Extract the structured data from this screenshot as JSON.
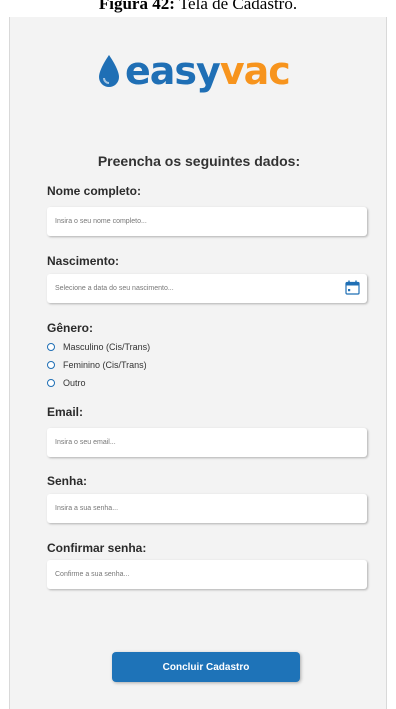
{
  "caption": {
    "figure": "Figura 42:",
    "title": "Tela de Cadastro."
  },
  "brand": {
    "part1": "easy",
    "part2": "vac",
    "primary_color": "#1f6fb5",
    "accent_color": "#f7941d"
  },
  "form": {
    "heading": "Preencha os seguintes dados:",
    "name_label": "Nome completo:",
    "name_placeholder": "Insira o seu nome completo...",
    "birth_label": "Nascimento:",
    "birth_placeholder": "Selecione a data do seu nascimento...",
    "gender_label": "Gênero:",
    "gender_options": [
      "Masculino (Cis/Trans)",
      "Feminino (Cis/Trans)",
      "Outro"
    ],
    "email_label": "Email:",
    "email_placeholder": "Insira o seu email...",
    "password_label": "Senha:",
    "password_placeholder": "Insira a sua senha...",
    "confirm_label": "Confirmar senha:",
    "confirm_placeholder": "Confirme a sua senha...",
    "submit_label": "Concluir Cadastro"
  }
}
